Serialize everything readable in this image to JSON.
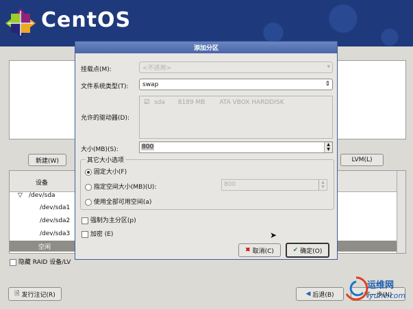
{
  "brand": "CentOS",
  "buttons": {
    "new": "新建(W)",
    "lvm": "LVM(L)",
    "release_notes": "发行注记(R)",
    "back": "后退(B)",
    "next": "下一步(N)"
  },
  "table": {
    "header_device": "设备",
    "rows": [
      "/dev/sda",
      "/dev/sda1",
      "/dev/sda2",
      "/dev/sda3"
    ],
    "selected_row": "空闲"
  },
  "hide_raid": "隐藏 RAID 设备/LV",
  "dialog": {
    "title": "添加分区",
    "mount_label": "挂载点(M):",
    "mount_value": "<不适用>",
    "fstype_label": "文件系统类型(T):",
    "fstype_value": "swap",
    "drives_label": "允许的驱动器(D):",
    "drive": {
      "name": "sda",
      "size": "8189 MB",
      "model": "ATA VBOX HARDDISK"
    },
    "size_label": "大小(MB)(S):",
    "size_value": "800",
    "options_title": "其它大小选项",
    "opt_fixed": "固定大小(F)",
    "opt_upto": "指定空间大小(MB)(U):",
    "opt_upto_value": "800",
    "opt_fill": "使用全部可用空间(a)",
    "force_primary": "强制为主分区(p)",
    "encrypt": "加密 (E)",
    "cancel": "取消(C)",
    "ok": "确定(O)"
  },
  "watermark": {
    "cn": "运维网",
    "url": "iyunv.com"
  }
}
